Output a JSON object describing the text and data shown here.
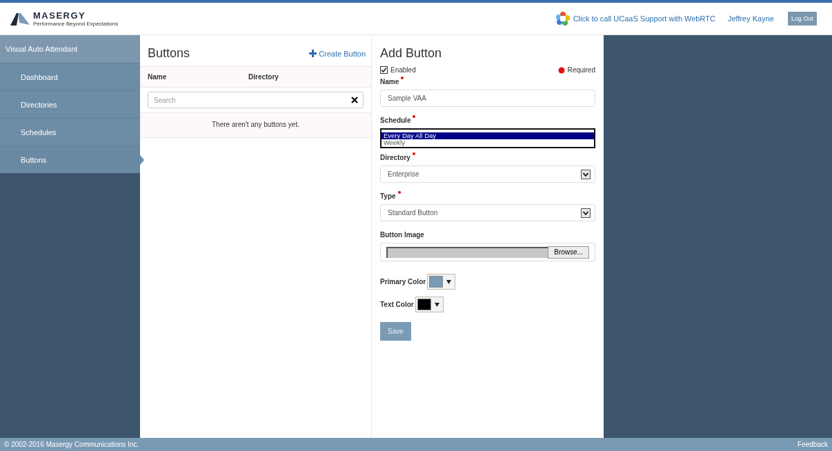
{
  "header": {
    "logo": "MASERGY",
    "tagline": "Performance Beyond Expectations",
    "call_link": "Click to call UCaaS Support with WebRTC",
    "user": "Jeffrey Kayne",
    "logout": "Log Out"
  },
  "sidebar": {
    "title": "Visual Auto Attendant",
    "items": [
      {
        "label": "Dashboard",
        "selected": false
      },
      {
        "label": "Directories",
        "selected": false
      },
      {
        "label": "Schedules",
        "selected": false
      },
      {
        "label": "Buttons",
        "selected": true
      }
    ]
  },
  "buttons_panel": {
    "title": "Buttons",
    "create_link": "Create Button",
    "columns": [
      "Name",
      "Directory"
    ],
    "search": {
      "placeholder": "Search"
    },
    "empty_message": "There aren't any buttons yet."
  },
  "form": {
    "title": "Add Button",
    "enabled": {
      "label": "Enabled",
      "checked": true
    },
    "required_label": "Required",
    "fields": [
      {
        "kind": "text",
        "label": "Name",
        "required": true,
        "value": "Sample VAA"
      },
      {
        "kind": "listbox",
        "label": "Schedule",
        "required": true,
        "options": [
          {
            "label": "Every Day All Day",
            "selected": true
          },
          {
            "label": "Weekly",
            "selected": false
          }
        ]
      },
      {
        "kind": "select",
        "label": "Directory",
        "required": true,
        "value": "Enterprise"
      },
      {
        "kind": "select",
        "label": "Type",
        "required": true,
        "value": "Standard Button"
      },
      {
        "kind": "file",
        "label": "Button Image",
        "required": false,
        "button": "Browse..."
      }
    ],
    "colors": [
      {
        "label": "Primary Color",
        "color": "#7b9bb5"
      },
      {
        "label": "Text Color",
        "color": "#000000"
      }
    ],
    "save": "Save"
  },
  "footer": {
    "copyright": "© 2002-2016 Masergy Communications Inc.",
    "feedback": "Feedback"
  }
}
